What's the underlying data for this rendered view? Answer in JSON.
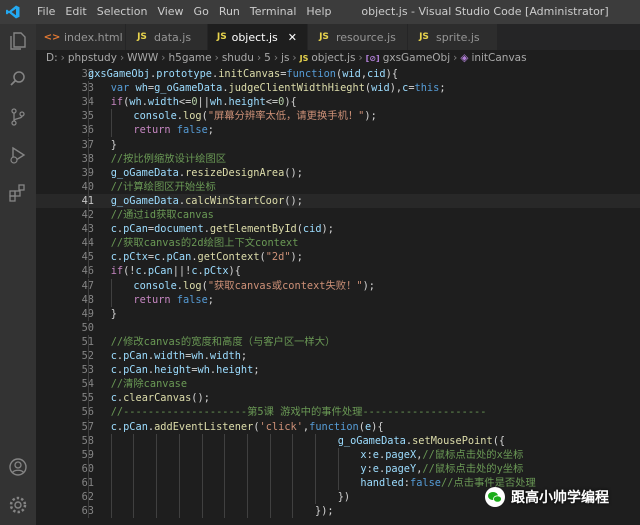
{
  "window": {
    "menu": [
      "File",
      "Edit",
      "Selection",
      "View",
      "Go",
      "Run",
      "Terminal",
      "Help"
    ],
    "title": "object.js - Visual Studio Code [Administrator]"
  },
  "tabs": [
    {
      "label": "index.html",
      "kind": "html"
    },
    {
      "label": "data.js",
      "kind": "js"
    },
    {
      "label": "object.js",
      "kind": "js",
      "active": true
    },
    {
      "label": "resource.js",
      "kind": "js"
    },
    {
      "label": "sprite.js",
      "kind": "js"
    }
  ],
  "breadcrumb": [
    "D:",
    "phpstudy",
    "WWW",
    "h5game",
    "shudu",
    "5",
    "js",
    "object.js",
    "gxsGameObj",
    "initCanvas"
  ],
  "editor": {
    "current_line": 41,
    "lines": [
      {
        "n": 32,
        "indent": 0,
        "tokens": [
          [
            "v",
            "gxsGameObj"
          ],
          [
            "p",
            "."
          ],
          [
            "v",
            "prototype"
          ],
          [
            "p",
            "."
          ],
          [
            "f",
            "initCanvas"
          ],
          [
            "o",
            "="
          ],
          [
            "k",
            "function"
          ],
          [
            "p",
            "("
          ],
          [
            "v",
            "wid"
          ],
          [
            "p",
            ","
          ],
          [
            "v",
            "cid"
          ],
          [
            "p",
            ")"
          ],
          [
            "p",
            "{"
          ]
        ]
      },
      {
        "n": 33,
        "indent": 1,
        "tokens": [
          [
            "k",
            "var "
          ],
          [
            "v",
            "wh"
          ],
          [
            "o",
            "="
          ],
          [
            "v",
            "g_oGameData"
          ],
          [
            "p",
            "."
          ],
          [
            "f",
            "judgeClientWidthHieght"
          ],
          [
            "p",
            "("
          ],
          [
            "v",
            "wid"
          ],
          [
            "p",
            "),"
          ],
          [
            "v",
            "c"
          ],
          [
            "o",
            "="
          ],
          [
            "k",
            "this"
          ],
          [
            "p",
            ";"
          ]
        ]
      },
      {
        "n": 34,
        "indent": 1,
        "tokens": [
          [
            "kc",
            "if"
          ],
          [
            "p",
            "("
          ],
          [
            "v",
            "wh"
          ],
          [
            "p",
            "."
          ],
          [
            "v",
            "width"
          ],
          [
            "o",
            "<="
          ],
          [
            "n",
            "0"
          ],
          [
            "o",
            "||"
          ],
          [
            "v",
            "wh"
          ],
          [
            "p",
            "."
          ],
          [
            "v",
            "height"
          ],
          [
            "o",
            "<="
          ],
          [
            "n",
            "0"
          ],
          [
            "p",
            "){"
          ]
        ]
      },
      {
        "n": 35,
        "indent": 2,
        "tokens": [
          [
            "v",
            "console"
          ],
          [
            "p",
            "."
          ],
          [
            "f",
            "log"
          ],
          [
            "p",
            "("
          ],
          [
            "s",
            "\"屏幕分辨率太低，请更换手机！\""
          ],
          [
            "p",
            ");"
          ]
        ]
      },
      {
        "n": 36,
        "indent": 2,
        "tokens": [
          [
            "kc",
            "return "
          ],
          [
            "k",
            "false"
          ],
          [
            "p",
            ";"
          ]
        ]
      },
      {
        "n": 37,
        "indent": 1,
        "tokens": [
          [
            "p",
            "}"
          ]
        ]
      },
      {
        "n": 38,
        "indent": 1,
        "tokens": [
          [
            "c",
            "//按比例缩放设计绘图区"
          ]
        ]
      },
      {
        "n": 39,
        "indent": 1,
        "tokens": [
          [
            "v",
            "g_oGameData"
          ],
          [
            "p",
            "."
          ],
          [
            "f",
            "resizeDesignArea"
          ],
          [
            "p",
            "();"
          ]
        ]
      },
      {
        "n": 40,
        "indent": 1,
        "tokens": [
          [
            "c",
            "//计算绘图区开始坐标"
          ]
        ]
      },
      {
        "n": 41,
        "indent": 1,
        "tokens": [
          [
            "v",
            "g_oGameData"
          ],
          [
            "p",
            "."
          ],
          [
            "f",
            "calcWinStartCoor"
          ],
          [
            "p",
            "();"
          ]
        ]
      },
      {
        "n": 42,
        "indent": 1,
        "tokens": [
          [
            "c",
            "//通过id获取canvas"
          ]
        ]
      },
      {
        "n": 43,
        "indent": 1,
        "tokens": [
          [
            "v",
            "c"
          ],
          [
            "p",
            "."
          ],
          [
            "v",
            "pCan"
          ],
          [
            "o",
            "="
          ],
          [
            "v",
            "document"
          ],
          [
            "p",
            "."
          ],
          [
            "f",
            "getElementById"
          ],
          [
            "p",
            "("
          ],
          [
            "v",
            "cid"
          ],
          [
            "p",
            ");"
          ]
        ]
      },
      {
        "n": 44,
        "indent": 1,
        "tokens": [
          [
            "c",
            "//获取canvas的2d绘图上下文context"
          ]
        ]
      },
      {
        "n": 45,
        "indent": 1,
        "tokens": [
          [
            "v",
            "c"
          ],
          [
            "p",
            "."
          ],
          [
            "v",
            "pCtx"
          ],
          [
            "o",
            "="
          ],
          [
            "v",
            "c"
          ],
          [
            "p",
            "."
          ],
          [
            "v",
            "pCan"
          ],
          [
            "p",
            "."
          ],
          [
            "f",
            "getContext"
          ],
          [
            "p",
            "("
          ],
          [
            "s",
            "\"2d\""
          ],
          [
            "p",
            ");"
          ]
        ]
      },
      {
        "n": 46,
        "indent": 1,
        "tokens": [
          [
            "kc",
            "if"
          ],
          [
            "p",
            "(!"
          ],
          [
            "v",
            "c"
          ],
          [
            "p",
            "."
          ],
          [
            "v",
            "pCan"
          ],
          [
            "o",
            "||"
          ],
          [
            "p",
            "!"
          ],
          [
            "v",
            "c"
          ],
          [
            "p",
            "."
          ],
          [
            "v",
            "pCtx"
          ],
          [
            "p",
            "){"
          ]
        ]
      },
      {
        "n": 47,
        "indent": 2,
        "tokens": [
          [
            "v",
            "console"
          ],
          [
            "p",
            "."
          ],
          [
            "f",
            "log"
          ],
          [
            "p",
            "("
          ],
          [
            "s",
            "\"获取canvas或context失败！\""
          ],
          [
            "p",
            ");"
          ]
        ]
      },
      {
        "n": 48,
        "indent": 2,
        "tokens": [
          [
            "kc",
            "return "
          ],
          [
            "k",
            "false"
          ],
          [
            "p",
            ";"
          ]
        ]
      },
      {
        "n": 49,
        "indent": 1,
        "tokens": [
          [
            "p",
            "}"
          ]
        ]
      },
      {
        "n": 50,
        "indent": 0,
        "tokens": []
      },
      {
        "n": 51,
        "indent": 1,
        "tokens": [
          [
            "c",
            "//修改canvas的宽度和高度（与客户区一样大）"
          ]
        ]
      },
      {
        "n": 52,
        "indent": 1,
        "tokens": [
          [
            "v",
            "c"
          ],
          [
            "p",
            "."
          ],
          [
            "v",
            "pCan"
          ],
          [
            "p",
            "."
          ],
          [
            "v",
            "width"
          ],
          [
            "o",
            "="
          ],
          [
            "v",
            "wh"
          ],
          [
            "p",
            "."
          ],
          [
            "v",
            "width"
          ],
          [
            "p",
            ";"
          ]
        ]
      },
      {
        "n": 53,
        "indent": 1,
        "tokens": [
          [
            "v",
            "c"
          ],
          [
            "p",
            "."
          ],
          [
            "v",
            "pCan"
          ],
          [
            "p",
            "."
          ],
          [
            "v",
            "height"
          ],
          [
            "o",
            "="
          ],
          [
            "v",
            "wh"
          ],
          [
            "p",
            "."
          ],
          [
            "v",
            "height"
          ],
          [
            "p",
            ";"
          ]
        ]
      },
      {
        "n": 54,
        "indent": 1,
        "tokens": [
          [
            "c",
            "//清除canvase"
          ]
        ]
      },
      {
        "n": 55,
        "indent": 1,
        "tokens": [
          [
            "v",
            "c"
          ],
          [
            "p",
            "."
          ],
          [
            "f",
            "clearCanvas"
          ],
          [
            "p",
            "();"
          ]
        ]
      },
      {
        "n": 56,
        "indent": 1,
        "tokens": [
          [
            "c",
            "//--------------------第5课 游戏中的事件处理--------------------"
          ]
        ]
      },
      {
        "n": 57,
        "indent": 1,
        "tokens": [
          [
            "v",
            "c"
          ],
          [
            "p",
            "."
          ],
          [
            "v",
            "pCan"
          ],
          [
            "p",
            "."
          ],
          [
            "f",
            "addEventListener"
          ],
          [
            "p",
            "("
          ],
          [
            "s",
            "'click'"
          ],
          [
            "p",
            ","
          ],
          [
            "k",
            "function"
          ],
          [
            "p",
            "("
          ],
          [
            "v",
            "e"
          ],
          [
            "p",
            "){"
          ]
        ]
      },
      {
        "n": 58,
        "indent": 11,
        "tokens": [
          [
            "v",
            "g_oGameData"
          ],
          [
            "p",
            "."
          ],
          [
            "f",
            "setMousePoint"
          ],
          [
            "p",
            "({"
          ]
        ]
      },
      {
        "n": 59,
        "indent": 12,
        "tokens": [
          [
            "v",
            "x"
          ],
          [
            "p",
            ":"
          ],
          [
            "v",
            "e"
          ],
          [
            "p",
            "."
          ],
          [
            "v",
            "pageX"
          ],
          [
            "p",
            ","
          ],
          [
            "c",
            "//鼠标点击处的x坐标"
          ]
        ]
      },
      {
        "n": 60,
        "indent": 12,
        "tokens": [
          [
            "v",
            "y"
          ],
          [
            "p",
            ":"
          ],
          [
            "v",
            "e"
          ],
          [
            "p",
            "."
          ],
          [
            "v",
            "pageY"
          ],
          [
            "p",
            ","
          ],
          [
            "c",
            "//鼠标点击处的y坐标"
          ]
        ]
      },
      {
        "n": 61,
        "indent": 12,
        "tokens": [
          [
            "v",
            "handled"
          ],
          [
            "p",
            ":"
          ],
          [
            "k",
            "false"
          ],
          [
            "c",
            "//点击事件是否处理"
          ]
        ]
      },
      {
        "n": 62,
        "indent": 11,
        "tokens": [
          [
            "p",
            "})"
          ]
        ]
      },
      {
        "n": 63,
        "indent": 10,
        "tokens": [
          [
            "p",
            "});"
          ]
        ]
      }
    ]
  },
  "watermark": {
    "text": "跟高小帅学编程"
  },
  "activity": [
    "explorer-icon",
    "search-icon",
    "source-control-icon",
    "run-debug-icon",
    "extensions-icon",
    "account-icon",
    "settings-icon"
  ]
}
